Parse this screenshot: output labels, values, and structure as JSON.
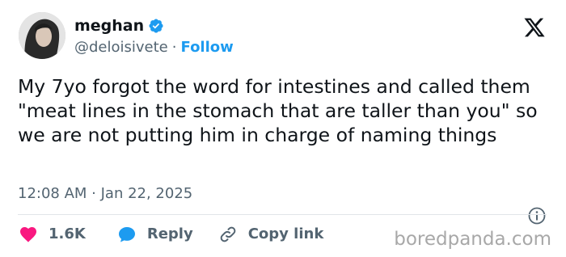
{
  "author": {
    "display_name": "meghan",
    "handle": "@deloisivete",
    "separator": "·",
    "follow_label": "Follow",
    "verified_color": "#1d9bf0"
  },
  "tweet": {
    "text": "My 7yo forgot the word for intestines and called them \"meat lines in the stomach that are taller than you\" so we are not putting him in charge of naming things",
    "timestamp": "12:08 AM · Jan 22, 2025"
  },
  "actions": {
    "likes_count": "1.6K",
    "reply_label": "Reply",
    "copy_link_label": "Copy link"
  },
  "icons": {
    "avatar": "profile-photo",
    "verified": "verified-badge-icon",
    "brand": "x-logo-icon",
    "info": "info-icon",
    "like": "heart-icon",
    "reply": "speech-bubble-icon",
    "copy": "link-icon"
  },
  "colors": {
    "like": "#f91880",
    "reply": "#1d9bf0",
    "link_accent": "#1d9bf0",
    "muted": "#536471"
  },
  "watermark": "boredpanda.com"
}
